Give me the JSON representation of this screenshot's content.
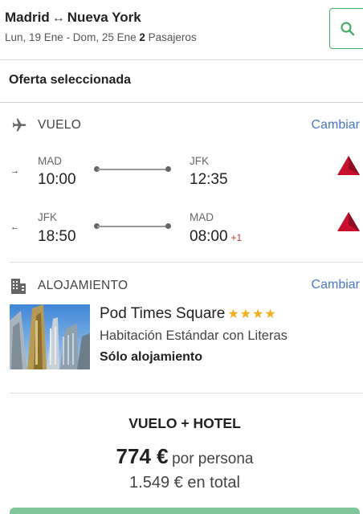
{
  "header": {
    "origin": "Madrid",
    "route_arrow": "↔",
    "destination": "Nueva York",
    "dates": "Lun, 19 Ene - Dom, 25 Ene",
    "passengers_count": "2",
    "passengers_label": "Pasajeros"
  },
  "selection": {
    "title": "Oferta seleccionada"
  },
  "flight": {
    "label": "VUELO",
    "change_label": "Cambiar",
    "outbound": {
      "direction": "→",
      "from_code": "MAD",
      "from_time": "10:00",
      "to_code": "JFK",
      "to_time": "12:35",
      "day_offset": ""
    },
    "return": {
      "direction": "←",
      "from_code": "JFK",
      "from_time": "18:50",
      "to_code": "MAD",
      "to_time": "08:00",
      "day_offset": "+1"
    },
    "airline_logo_color": "#c8102e"
  },
  "hotel": {
    "label": "ALOJAMIENTO",
    "change_label": "Cambiar",
    "name": "Pod Times Square",
    "stars": "★★★★",
    "star_rating": 4,
    "room": "Habitación Estándar con Literas",
    "board": "Sólo alojamiento"
  },
  "totals": {
    "package_title": "VUELO + HOTEL",
    "price_per_person": "774 €",
    "per_person_label": "por persona",
    "total_amount": "1.549 €",
    "total_label": "en total"
  },
  "colors": {
    "accent_green": "#4aaa6b",
    "link_blue": "#4a78c4",
    "star_gold": "#f2b01e",
    "offset_red": "#c0392b"
  }
}
